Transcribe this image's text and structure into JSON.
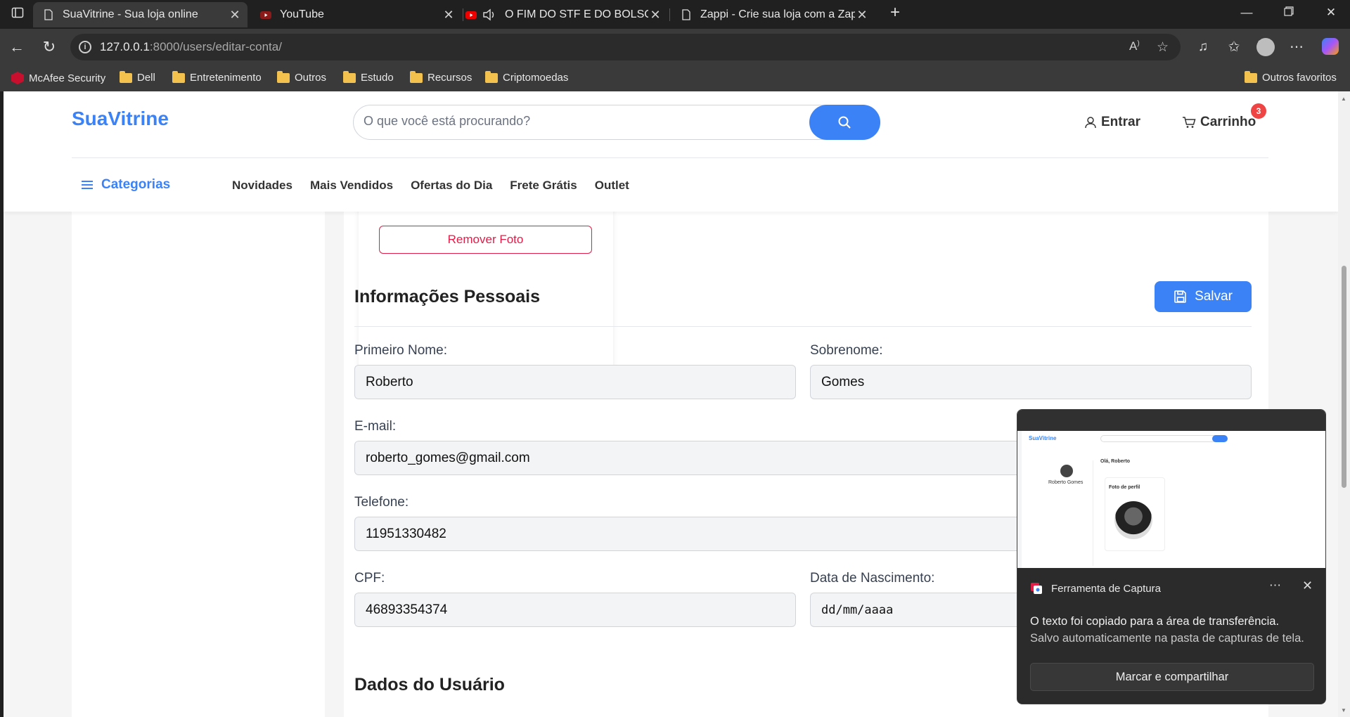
{
  "browser": {
    "tabs": [
      {
        "title": "SuaVitrine - Sua loja online",
        "icon": "page-icon"
      },
      {
        "title": "YouTube",
        "icon": "youtube-icon"
      },
      {
        "title": "O FIM DO STF E DO BOLSON",
        "icon": "youtube-icon"
      },
      {
        "title": "Zappi - Crie sua loja com a Zappi",
        "icon": "page-icon"
      }
    ],
    "url_host": "127.0.0.1",
    "url_path": ":8000/users/editar-conta/",
    "bookmarks": [
      "McAfee Security",
      "Dell",
      "Entretenimento",
      "Outros",
      "Estudo",
      "Recursos",
      "Criptomoedas"
    ],
    "other_favorites": "Outros favoritos"
  },
  "site": {
    "logo": "SuaVitrine",
    "search_placeholder": "O que você está procurando?",
    "login": "Entrar",
    "cart": "Carrinho",
    "cart_count": "3",
    "categories": "Categorias",
    "menu": [
      "Novidades",
      "Mais Vendidos",
      "Ofertas do Dia",
      "Frete Grátis",
      "Outlet"
    ]
  },
  "form": {
    "remove_photo": "Remover Foto",
    "personal_title": "Informações Pessoais",
    "save": "Salvar",
    "first_name_label": "Primeiro Nome:",
    "first_name": "Roberto",
    "last_name_label": "Sobrenome:",
    "last_name": "Gomes",
    "email_label": "E-mail:",
    "email": "roberto_gomes@gmail.com",
    "phone_label": "Telefone:",
    "phone": "11951330482",
    "cpf_label": "CPF:",
    "cpf": "46893354374",
    "birth_label": "Data de Nascimento:",
    "birth": "dd/mm/aaaa",
    "user_data_title": "Dados do Usuário"
  },
  "toast": {
    "app": "Ferramenta de Captura",
    "message": "O texto foi copiado para a área de transferência.",
    "sub": "Salvo automaticamente na pasta de capturas de tela.",
    "button": "Marcar e compartilhar",
    "preview": {
      "logo": "SuaVitrine",
      "greeting": "Olá, Roberto",
      "user": "Roberto Gomes",
      "card_title": "Foto de perfil"
    }
  },
  "colors": {
    "accent": "#3b82f6",
    "danger": "#e11d48",
    "badge": "#ef4444"
  }
}
